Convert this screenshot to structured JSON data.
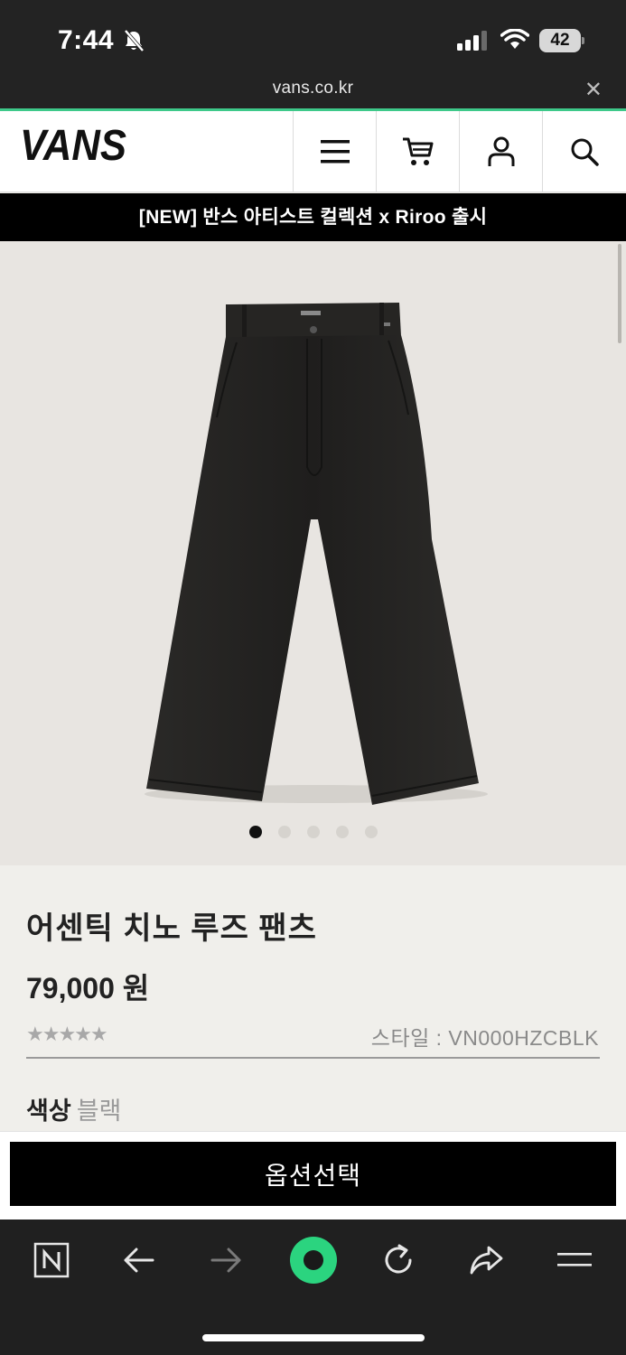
{
  "status_bar": {
    "time": "7:44",
    "battery": "42",
    "icons": [
      "bell-slash-icon",
      "cell-signal-icon",
      "wifi-icon",
      "battery-icon"
    ]
  },
  "browser": {
    "url": "vans.co.kr",
    "close_icon": "close-icon",
    "toolbar_icons": [
      "naver-n-icon",
      "back-arrow-icon",
      "forward-arrow-icon",
      "green-dot-icon",
      "reload-icon",
      "share-icon",
      "menu-icon"
    ]
  },
  "header": {
    "logo": "VANS",
    "icons": [
      "hamburger-menu-icon",
      "cart-icon",
      "user-icon",
      "search-icon"
    ]
  },
  "banner": {
    "text": "[NEW] 반스 아티스트 컬렉션 x Riroo 출시"
  },
  "gallery": {
    "image_count": 5,
    "active_index": 0
  },
  "product": {
    "title": "어센틱 치노 루즈 팬츠",
    "price": "79,000 원",
    "rating_stars": "★★★★★",
    "style_label": "스타일 : VN000HZCBLK",
    "color_label": "색상",
    "color_value": "블랙",
    "cta_label": "옵션선택"
  },
  "colors": {
    "accent": "#3ec98a",
    "status_bg": "#232323",
    "banner_bg": "#000000",
    "image_bg": "#e8e5e1",
    "info_bg": "#f0efeb"
  }
}
